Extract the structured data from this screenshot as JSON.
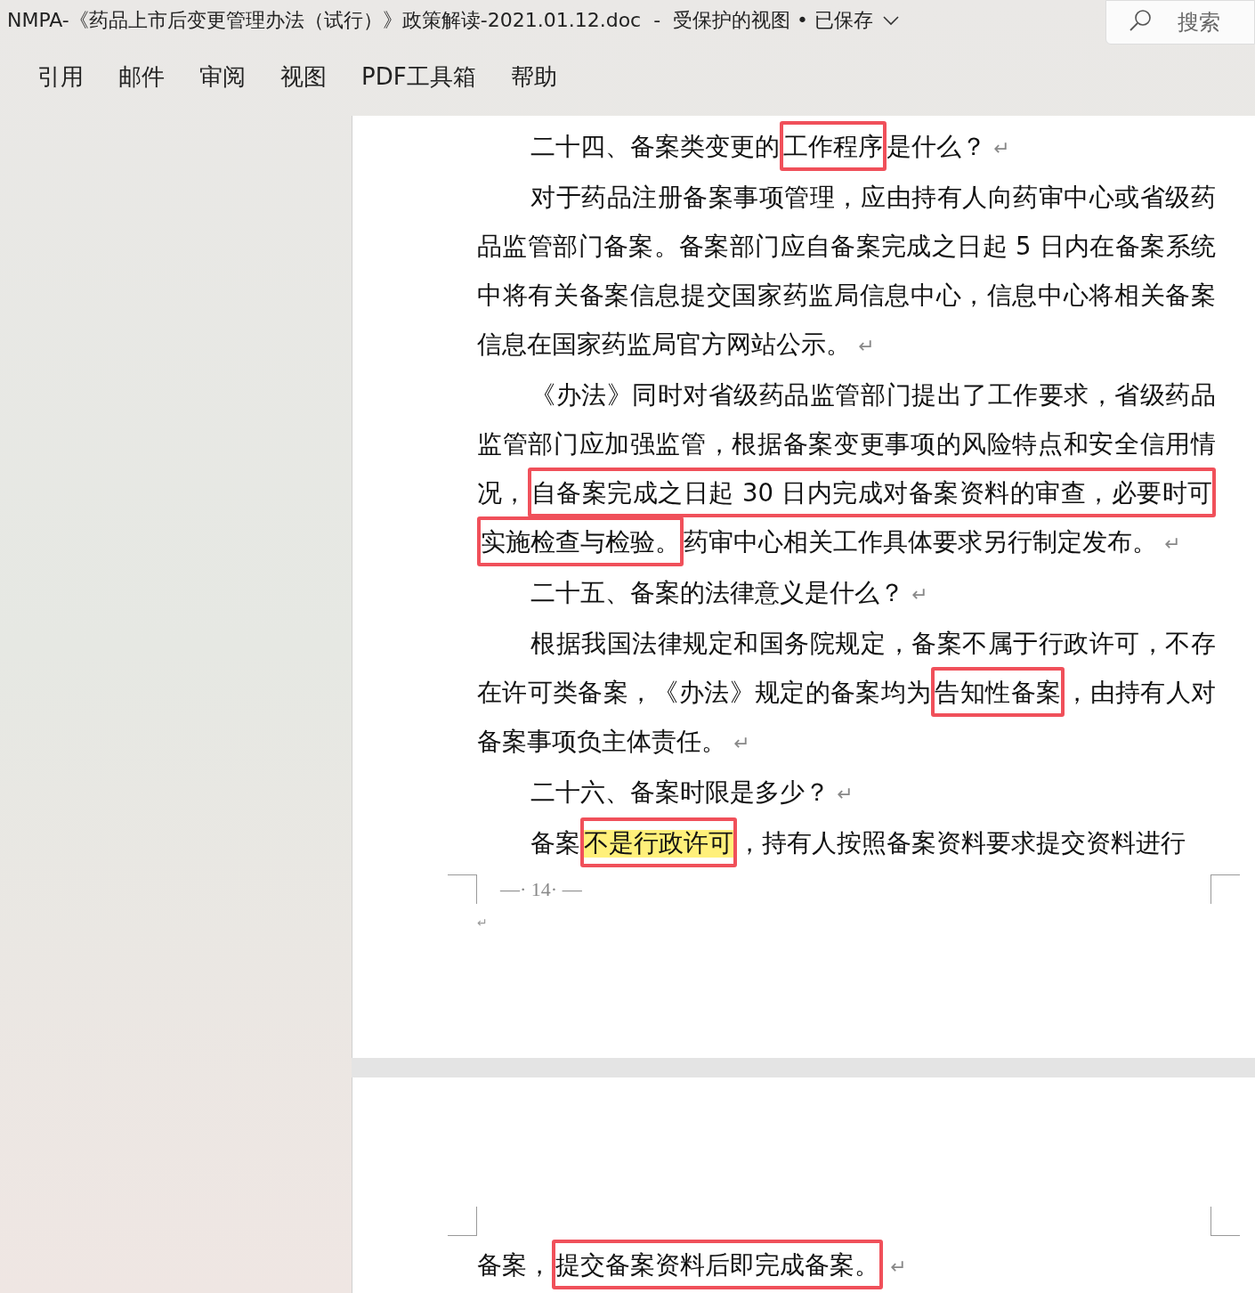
{
  "window": {
    "title": "NMPA-《药品上市后变更管理办法（试行）》政策解读-2021.01.12.doc  -  受保护的视图 • 已保存",
    "search": {
      "placeholder": "搜索"
    }
  },
  "ribbon_tabs": [
    {
      "label": "引用",
      "selected": false
    },
    {
      "label": "邮件",
      "selected": false
    },
    {
      "label": "审阅",
      "selected": false
    },
    {
      "label": "视图",
      "selected": false
    },
    {
      "label": "PDF工具箱",
      "selected": false
    },
    {
      "label": "帮助",
      "selected": false
    }
  ],
  "pages": [
    {
      "paragraphs": [
        {
          "kind": "heading",
          "segments": [
            {
              "text": "二十四、备案类变更的",
              "boxed": false,
              "highlighted": false
            },
            {
              "text": "工作程序",
              "boxed": true,
              "highlighted": false
            },
            {
              "text": "是什么？",
              "boxed": false,
              "highlighted": false
            }
          ],
          "return_mark": "↵"
        },
        {
          "kind": "body",
          "segments": [
            {
              "text": "对于药品注册备案事项管理，应由持有人向药审中心或省级药品监管部门备案。备案部门应自备案完成之日起 5 日内在备案系统中将有关备案信息提交国家药监局信息中心，信息中心将相关备案信息在国家药监局官方网站公示。",
              "boxed": false,
              "highlighted": false
            }
          ],
          "return_mark": "↵"
        },
        {
          "kind": "body",
          "segments": [
            {
              "text": "《办法》同时对省级药品监管部门提出了工作要求，省级药品监管部门应加强监管，根据备案变更事项的风险特点和安全信用情况，",
              "boxed": false,
              "highlighted": false
            },
            {
              "text": "自备案完成之日起 30 日内完成对备案资料的审查，必要时可实施检查与检验。",
              "boxed": true,
              "highlighted": false
            },
            {
              "text": "药审中心相关工作具体要求另行制定发布。",
              "boxed": false,
              "highlighted": false
            }
          ],
          "return_mark": "↵"
        },
        {
          "kind": "heading",
          "segments": [
            {
              "text": "二十五、备案的法律意义是什么？",
              "boxed": false,
              "highlighted": false
            }
          ],
          "return_mark": "↵"
        },
        {
          "kind": "body",
          "segments": [
            {
              "text": "根据我国法律规定和国务院规定，备案不属于行政许可，不存在许可类备案，《办法》规定的备案均为",
              "boxed": false,
              "highlighted": false
            },
            {
              "text": "告知性备案",
              "boxed": true,
              "highlighted": false
            },
            {
              "text": "，由持有人对备案事项负主体责任。",
              "boxed": false,
              "highlighted": false
            }
          ],
          "return_mark": "↵"
        },
        {
          "kind": "heading",
          "segments": [
            {
              "text": "二十六、备案时限是多少？",
              "boxed": false,
              "highlighted": false
            }
          ],
          "return_mark": "↵"
        },
        {
          "kind": "body",
          "segments": [
            {
              "text": "备案",
              "boxed": false,
              "highlighted": false
            },
            {
              "text": "不是行政许可",
              "boxed": true,
              "highlighted": true
            },
            {
              "text": "，持有人按照备案资料要求提交资料进行",
              "boxed": false,
              "highlighted": false
            }
          ]
        }
      ],
      "page_number": "—· 14· —",
      "footer_return_mark": "↵"
    },
    {
      "paragraphs": [
        {
          "kind": "continuation",
          "segments": [
            {
              "text": "备案，",
              "boxed": false,
              "highlighted": false
            },
            {
              "text": "提交备案资料后即完成备案。",
              "boxed": true,
              "highlighted": false
            }
          ],
          "return_mark": "↵"
        }
      ]
    }
  ]
}
